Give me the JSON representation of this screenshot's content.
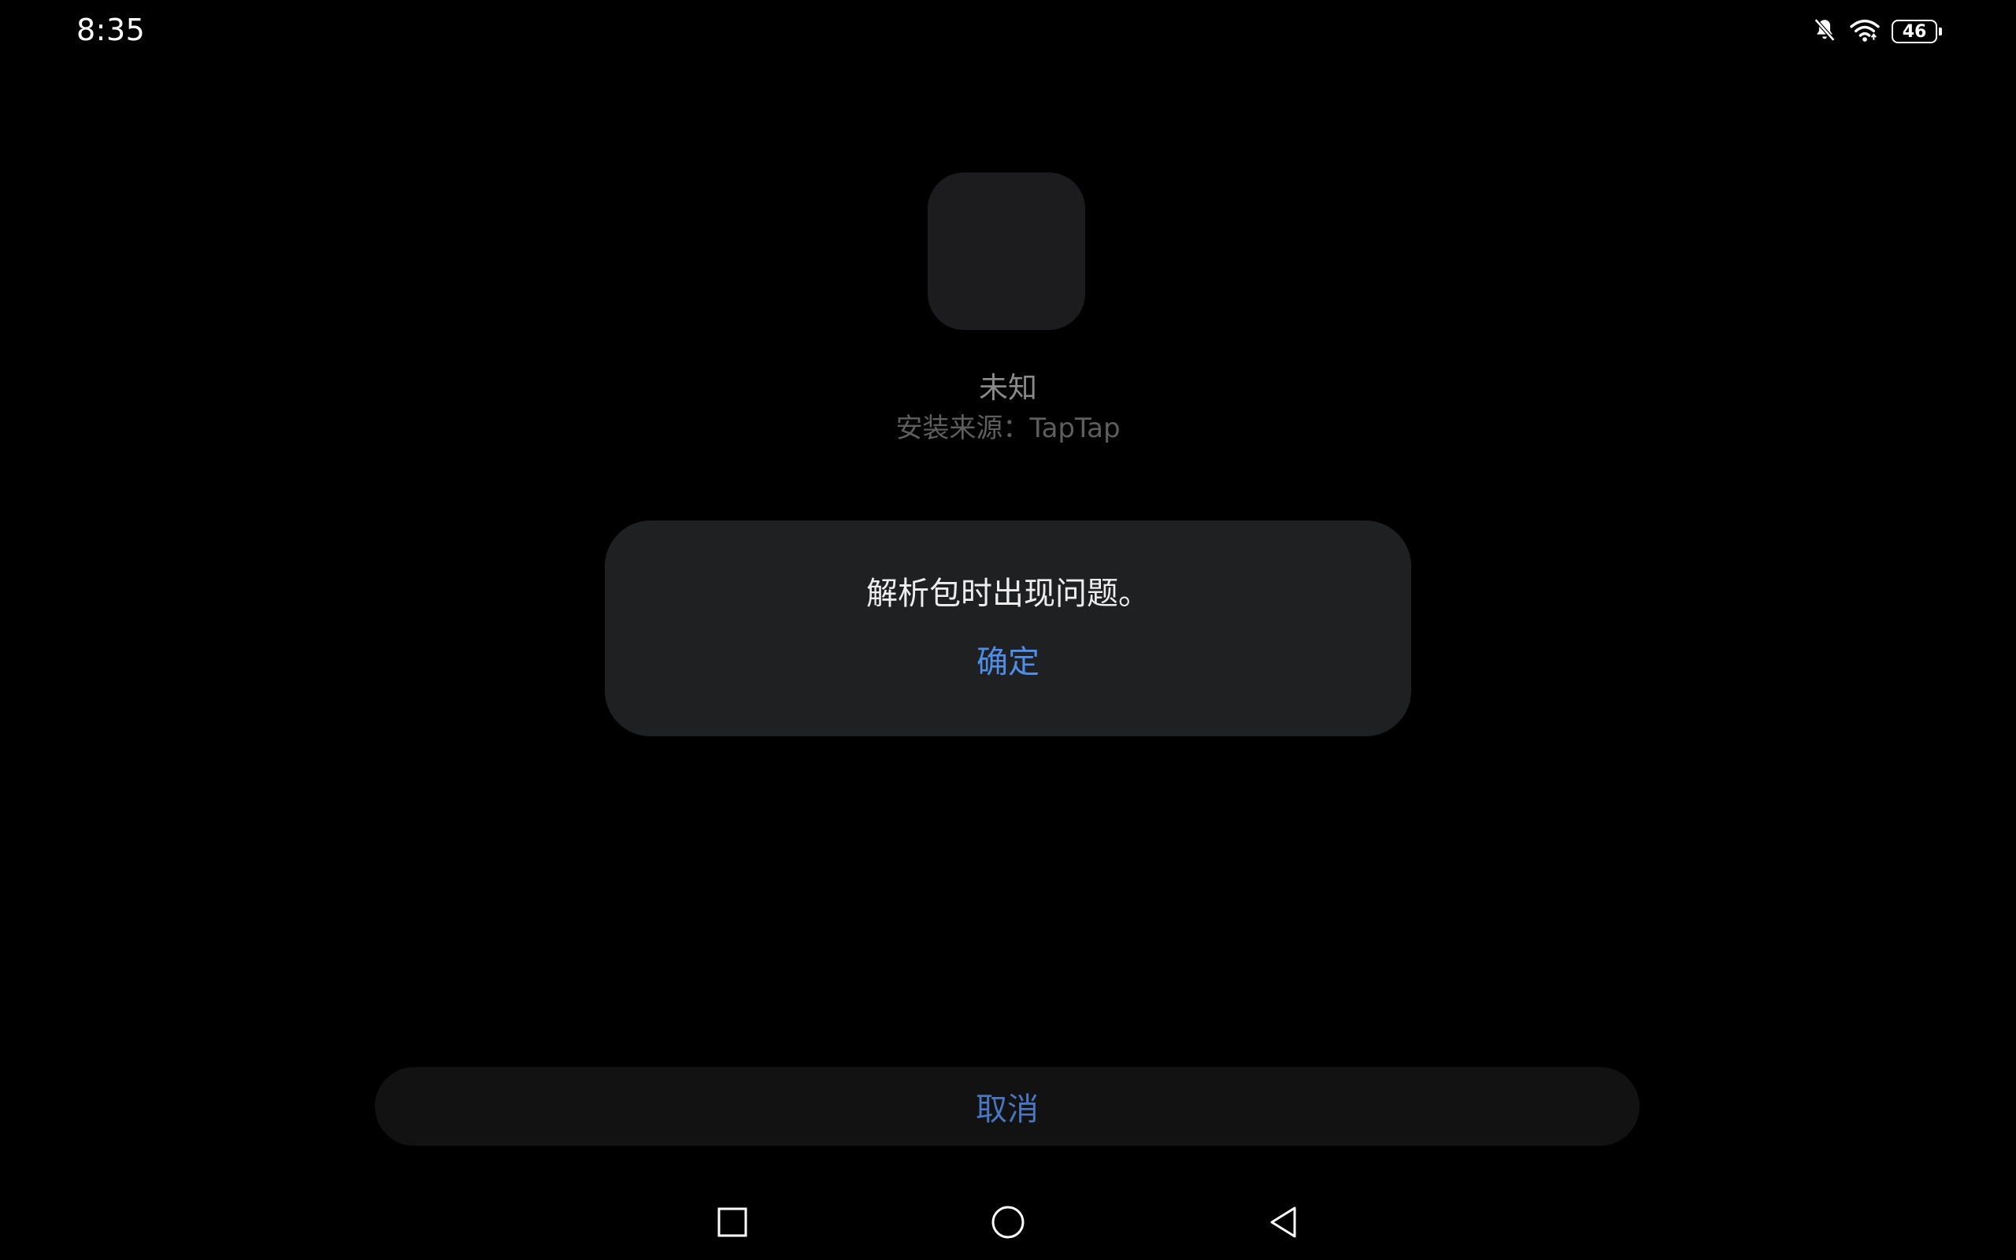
{
  "status_bar": {
    "time": "8:35",
    "battery_level": "46",
    "icons": [
      "notifications-off-icon",
      "wifi-icon",
      "battery-icon"
    ]
  },
  "app": {
    "icon": "app-placeholder-icon",
    "name": "未知",
    "install_source": "安装来源：TapTap"
  },
  "dialog": {
    "message": "解析包时出现问题。",
    "confirm_label": "确定"
  },
  "footer": {
    "cancel_label": "取消"
  },
  "nav_bar": {
    "icons": [
      "recent-apps-icon",
      "home-icon",
      "back-icon"
    ]
  },
  "colors": {
    "background": "#000000",
    "dialog_background": "#1f2022",
    "accent": "#4f8de8",
    "cancel_text": "#4a76c0"
  }
}
